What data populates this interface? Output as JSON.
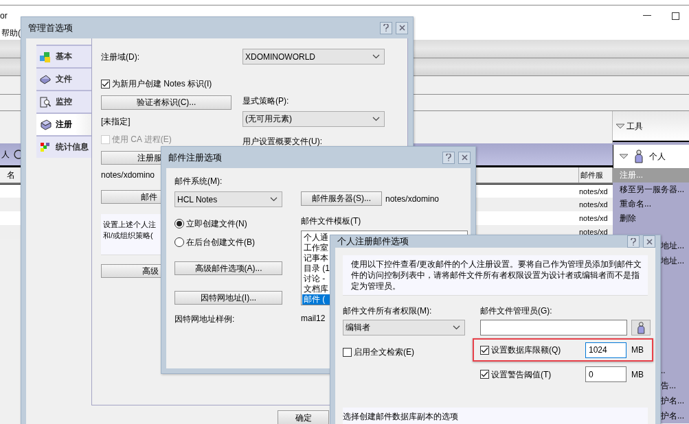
{
  "app": {
    "title": "or",
    "menu": "帮助(",
    "header_mark": "人",
    "column_1": "名",
    "column_mail": "邮件服",
    "rows": [
      "notes/xd",
      "notes/xd",
      "notes/xd",
      "notes/xd"
    ],
    "tools": {
      "title": "工具",
      "section": "个人",
      "items": [
        {
          "label": "注册...",
          "selected": true
        },
        {
          "label": "移至另一服务器...",
          "selected": false
        },
        {
          "label": "重命名...",
          "selected": false
        },
        {
          "label": "删除",
          "selected": false
        }
      ],
      "items_upper_partial": [
        "地址...",
        "地址..."
      ],
      "items_lower_partial": [
        "..",
        "告...",
        "护名...",
        "护名..."
      ]
    }
  },
  "admin_dialog": {
    "title": "管理首选项",
    "nav": [
      {
        "label": "基本",
        "selected": false
      },
      {
        "label": "文件",
        "selected": false
      },
      {
        "label": "监控",
        "selected": false
      },
      {
        "label": "注册",
        "selected": true
      },
      {
        "label": "统计信息",
        "selected": false
      }
    ],
    "domain_label": "注册域(D):",
    "domain": "XDOMINOWORLD",
    "create_id": {
      "label": "为新用户创建 Notes 标识(I)",
      "checked": true,
      "disabled": false
    },
    "certifier_button": "验证者标识(C)...",
    "certifier": "[未指定]",
    "ca_process": {
      "label": "使用 CA 进程(E)",
      "checked": false,
      "disabled": true
    },
    "server_button": "注册服",
    "server": "notes/xdomino",
    "mail_button": "邮件",
    "summary_lines": [
      "设置上述个人注",
      "和/或组织策略("
    ],
    "advanced_button": "高级",
    "policy_label": "显式策略(P):",
    "policy": "(无可用元素)",
    "profile_label": "用户设置概要文件(U):",
    "ok_button": "确定"
  },
  "mail_dialog": {
    "title": "邮件注册选项",
    "system_label": "邮件系统(M):",
    "system": "HCL Notes",
    "create_options": [
      {
        "label": "立即创建文件(N)",
        "selected": true
      },
      {
        "label": "在后台创建文件(B)",
        "selected": false
      }
    ],
    "advanced_button": "高级邮件选项(A)...",
    "internet_button": "因特网地址(I)...",
    "sample_label": "因特网地址样例:",
    "sample": "mail12",
    "server_button": "邮件服务器(S)...",
    "server": "notes/xdomino",
    "template_label": "邮件文件模板(T)",
    "templates": [
      {
        "label": "个人通",
        "selected": false
      },
      {
        "label": "工作室",
        "selected": false
      },
      {
        "label": "记事本",
        "selected": false
      },
      {
        "label": "目录 (1",
        "selected": false
      },
      {
        "label": "讨论 -",
        "selected": false
      },
      {
        "label": "文档库",
        "selected": false
      },
      {
        "label": "邮件 (",
        "selected": true
      }
    ]
  },
  "person_dialog": {
    "title": "个人注册邮件选项",
    "info": "使用以下控件查看/更改邮件的个人注册设置。要将自己作为管理员添加到邮件文件的访问控制列表中，请将邮件文件所有者权限设置为设计者或编辑者而不是指定为管理员。",
    "owner_label": "邮件文件所有者权限(M):",
    "owner": "编辑者",
    "fulltext": {
      "label": "启用全文检索(E)",
      "checked": false
    },
    "manager_label": "邮件文件管理员(G):",
    "quota": {
      "label": "设置数据库限额(Q)",
      "checked": true,
      "value": "1024",
      "unit": "MB",
      "focused": true
    },
    "warning": {
      "label": "设置警告阈值(T)",
      "checked": true,
      "value": "0",
      "unit": "MB",
      "focused": false
    },
    "replica_title": "选择创建邮件数据库副本的选项"
  }
}
